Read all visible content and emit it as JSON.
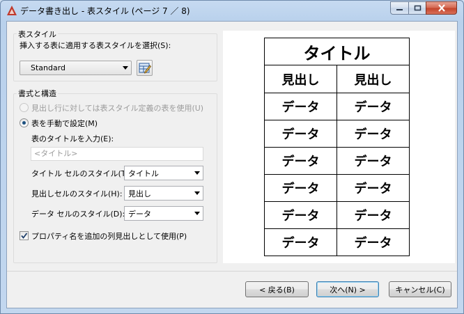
{
  "window": {
    "title": "データ書き出し - 表スタイル (ページ 7 ／ 8)",
    "icon": "autocad-a-icon",
    "accent": "#c0392b"
  },
  "table_style": {
    "group_label": "表スタイル",
    "select_label": "挿入する表に適用する表スタイルを選択(S):",
    "selected": "Standard",
    "edit_icon": "table-style-edit-icon"
  },
  "format": {
    "group_label": "書式と構造",
    "radio_header_row": "見出し行に対しては表スタイル定義の表を使用(U)",
    "radio_manual": "表を手動で設定(M)",
    "title_label": "表のタイトルを入力(E):",
    "title_placeholder": "<タイトル>",
    "title_cell_label": "タイトル セルのスタイル(T):",
    "title_cell_value": "タイトル",
    "header_cell_label": "見出しセルのスタイル(H):",
    "header_cell_value": "見出し",
    "data_cell_label": "データ セルのスタイル(D):",
    "data_cell_value": "データ",
    "checkbox_label": "プロパティ名を追加の列見出しとして使用(P)",
    "checkbox_checked": true
  },
  "preview": {
    "title": "タイトル",
    "headers": [
      "見出し",
      "見出し"
    ],
    "rows": [
      [
        "データ",
        "データ"
      ],
      [
        "データ",
        "データ"
      ],
      [
        "データ",
        "データ"
      ],
      [
        "データ",
        "データ"
      ],
      [
        "データ",
        "データ"
      ],
      [
        "データ",
        "データ"
      ]
    ]
  },
  "footer": {
    "back": "< 戻る(B)",
    "next": "次へ(N) >",
    "cancel": "キャンセル(C)"
  }
}
